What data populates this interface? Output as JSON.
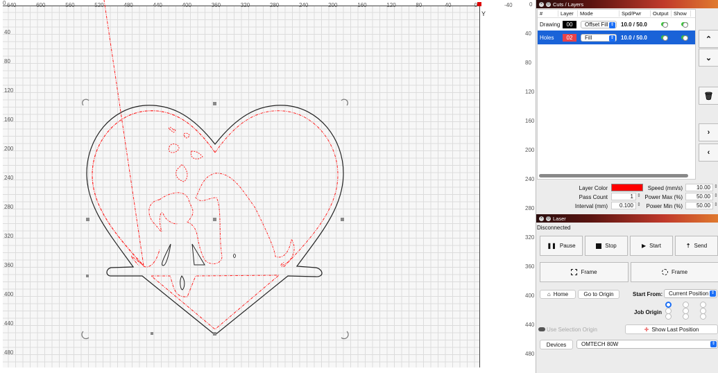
{
  "canvas": {
    "x_ruler": [
      "640",
      "600",
      "560",
      "520",
      "480",
      "440",
      "400",
      "360",
      "320",
      "280",
      "240",
      "200",
      "160",
      "120",
      "80",
      "40",
      "0"
    ],
    "y_ruler": [
      "40",
      "80",
      "120",
      "160",
      "200",
      "240",
      "280",
      "320",
      "360",
      "400",
      "440",
      "480"
    ],
    "right_ruler": [
      "0",
      "40",
      "80",
      "120",
      "160",
      "200",
      "240",
      "280",
      "320",
      "360",
      "400",
      "440",
      "480"
    ],
    "top_right_label": "-40",
    "axis_label_y": "Y",
    "origin_label": "0",
    "small_label": "0",
    "colors": {
      "cut_line": "#222222",
      "fill_line": "#ff2020",
      "grid": "#dcdcdc"
    }
  },
  "cuts": {
    "title": "Cuts / Layers",
    "columns": [
      "#",
      "Layer",
      "Mode",
      "Spd/Pwr",
      "Output",
      "Show"
    ],
    "rows": [
      {
        "name": "Drawing",
        "layer": "00",
        "layer_color": "#000000",
        "mode": "Offset Fill",
        "spdpwr": "10.0 / 50.0",
        "output": true,
        "show": true,
        "selected": false
      },
      {
        "name": "Holes",
        "layer": "02",
        "layer_color": "#e8424a",
        "mode": "Fill",
        "spdpwr": "10.0 / 50.0",
        "output": true,
        "show": true,
        "selected": true
      }
    ],
    "side_buttons": [
      "chevron-up",
      "chevron-down",
      "trash",
      "chevron-right",
      "chevron-left"
    ],
    "props": {
      "layer_color_label": "Layer Color",
      "layer_color": "#ff0000",
      "pass_count_label": "Pass Count",
      "pass_count": "1",
      "interval_label": "Interval (mm)",
      "interval": "0.100",
      "speed_label": "Speed (mm/s)",
      "speed": "10.00",
      "power_max_label": "Power Max (%)",
      "power_max": "50.00",
      "power_min_label": "Power Min (%)",
      "power_min": "50.00"
    }
  },
  "laser": {
    "title": "Laser",
    "status": "Disconnected",
    "pause": "Pause",
    "stop": "Stop",
    "start": "Start",
    "send": "Send",
    "frame1": "Frame",
    "frame2": "Frame",
    "home": "Home",
    "go_origin": "Go to Origin",
    "start_from_label": "Start From:",
    "start_from": "Current Position",
    "job_origin_label": "Job Origin",
    "job_origin_selected": "top-left",
    "use_selection_origin": "Use Selection Origin",
    "show_last_position": "Show Last Position",
    "devices": "Devices",
    "device": "OMTECH 80W"
  }
}
